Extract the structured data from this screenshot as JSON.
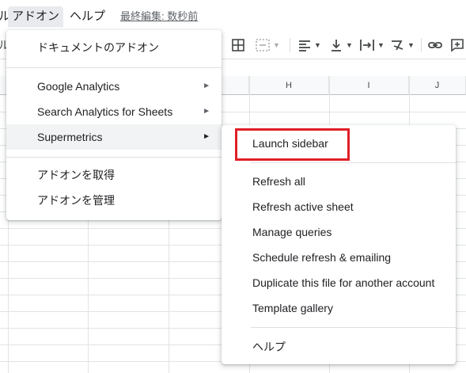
{
  "menubar": {
    "partial_left": "ル",
    "addons": "アドオン",
    "help": "ヘルプ",
    "last_edit": "最終編集: 数秒前",
    "partial_toolbar": "ル"
  },
  "toolbar": {
    "icons": [
      "borders-icon",
      "merge-cells-icon",
      "align-left-icon",
      "vertical-align-icon",
      "text-rotation-icon",
      "text-wrap-icon",
      "link-icon",
      "comment-icon"
    ]
  },
  "grid": {
    "columns": [
      "H",
      "I",
      "J"
    ]
  },
  "addons_menu": {
    "get_docs": "ドキュメントのアドオン",
    "items": [
      {
        "label": "Google Analytics",
        "has_submenu": true
      },
      {
        "label": "Search Analytics for Sheets",
        "has_submenu": true
      },
      {
        "label": "Supermetrics",
        "has_submenu": true,
        "active": true
      }
    ],
    "get_addons": "アドオンを取得",
    "manage_addons": "アドオンを管理",
    "submenu_arrow": "►"
  },
  "supermetrics_menu": {
    "launch_sidebar": "Launch sidebar",
    "items": [
      "Refresh all",
      "Refresh active sheet",
      "Manage queries",
      "Schedule refresh & emailing",
      "Duplicate this file for another account",
      "Template gallery"
    ],
    "help": "ヘルプ"
  },
  "colors": {
    "highlight": "#e01f26",
    "active_row": "#f1f3f4"
  }
}
